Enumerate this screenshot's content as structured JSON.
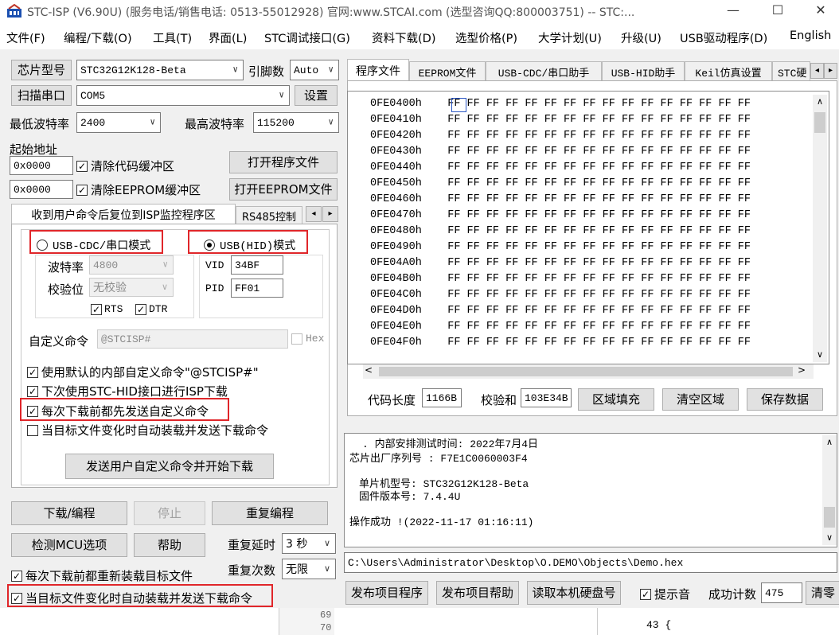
{
  "window": {
    "title": "STC-ISP (V6.90U) (服务电话/销售电话: 0513-55012928) 官网:www.STCAI.com  (选型咨询QQ:800003751) -- STC:...",
    "minimize": "—",
    "maximize": "☐",
    "close": "✕"
  },
  "menu": [
    "文件(F)",
    "编程/下载(O)",
    "工具(T)",
    "界面(L)",
    "STC调试接口(G)",
    "资料下载(D)",
    "选型价格(P)",
    "大学计划(U)",
    "升级(U)",
    "USB驱动程序(D)",
    "English"
  ],
  "left": {
    "chip_label": "芯片型号",
    "chip_value": "STC32G12K128-Beta",
    "pin_label": "引脚数",
    "pin_value": "Auto",
    "scan_label": "扫描串口",
    "port_value": "COM5",
    "settings_label": "设置",
    "min_baud_label": "最低波特率",
    "min_baud_value": "2400",
    "max_baud_label": "最高波特率",
    "max_baud_value": "115200",
    "start_addr_label": "起始地址",
    "addr1": "0x0000",
    "clear_code": "清除代码缓冲区",
    "open_prog": "打开程序文件",
    "addr2": "0x0000",
    "clear_eeprom": "清除EEPROM缓冲区",
    "open_eeprom": "打开EEPROM文件",
    "tab1": "收到用户命令后复位到ISP监控程序区",
    "tab2": "RS485控制",
    "radio_cdc": "USB-CDC/串口模式",
    "radio_hid": "USB(HID)模式",
    "baud_label": "波特率",
    "baud_value": "4800",
    "parity_label": "校验位",
    "parity_value": "无校验",
    "vid_label": "VID",
    "vid_value": "34BF",
    "pid_label": "PID",
    "pid_value": "FF01",
    "rts": "RTS",
    "dtr": "DTR",
    "custom_cmd_label": "自定义命令",
    "custom_cmd_value": "@STCISP#",
    "hex_label": "Hex",
    "opt1": "使用默认的内部自定义命令\"@STCISP#\"",
    "opt2": "下次使用STC-HID接口进行ISP下载",
    "opt3": "每次下载前都先发送自定义命令",
    "opt4": "当目标文件变化时自动装载并发送下载命令",
    "send_btn": "发送用户自定义命令并开始下载",
    "download_btn": "下载/编程",
    "stop_btn": "停止",
    "reprog_btn": "重复编程",
    "detect_btn": "检测MCU选项",
    "help_btn": "帮助",
    "repeat_delay_label": "重复延时",
    "repeat_delay_value": "3 秒",
    "reload_each": "每次下载前都重新装载目标文件",
    "repeat_count_label": "重复次数",
    "repeat_count_value": "无限",
    "auto_reload": "当目标文件变化时自动装载并发送下载命令"
  },
  "right": {
    "tabs": [
      "程序文件",
      "EEPROM文件",
      "USB-CDC/串口助手",
      "USB-HID助手",
      "Keil仿真设置",
      "STC硬"
    ],
    "hex_addresses": [
      "0FE0400h",
      "0FE0410h",
      "0FE0420h",
      "0FE0430h",
      "0FE0440h",
      "0FE0450h",
      "0FE0460h",
      "0FE0470h",
      "0FE0480h",
      "0FE0490h",
      "0FE04A0h",
      "0FE04B0h",
      "0FE04C0h",
      "0FE04D0h",
      "0FE04E0h",
      "0FE04F0h"
    ],
    "hex_bytes": "FF FF FF FF FF FF FF FF FF FF FF FF FF FF FF FF",
    "code_len_label": "代码长度",
    "code_len_value": "1166B",
    "checksum_label": "校验和",
    "checksum_value": "103E34B",
    "fill_btn": "区域填充",
    "clear_btn": "清空区域",
    "save_btn": "保存数据",
    "log_lines": [
      ". 内部安排测试时间: 2022年7月4日",
      "芯片出厂序列号 : F7E1C0060003F4",
      "",
      "单片机型号: STC32G12K128-Beta",
      "固件版本号: 7.4.4U",
      "",
      "操作成功 !(2022-11-17 01:16:11)"
    ],
    "path_value": "C:\\Users\\Administrator\\Desktop\\O.DEMO\\Objects\\Demo.hex",
    "publish_prog": "发布项目程序",
    "publish_help": "发布项目帮助",
    "read_disk": "读取本机硬盘号",
    "beep_label": "提示音",
    "success_label": "成功计数",
    "success_value": "475",
    "clear_count": "清零"
  },
  "background": {
    "line_a": "69",
    "line_b": "70",
    "line_c": "43 {"
  }
}
